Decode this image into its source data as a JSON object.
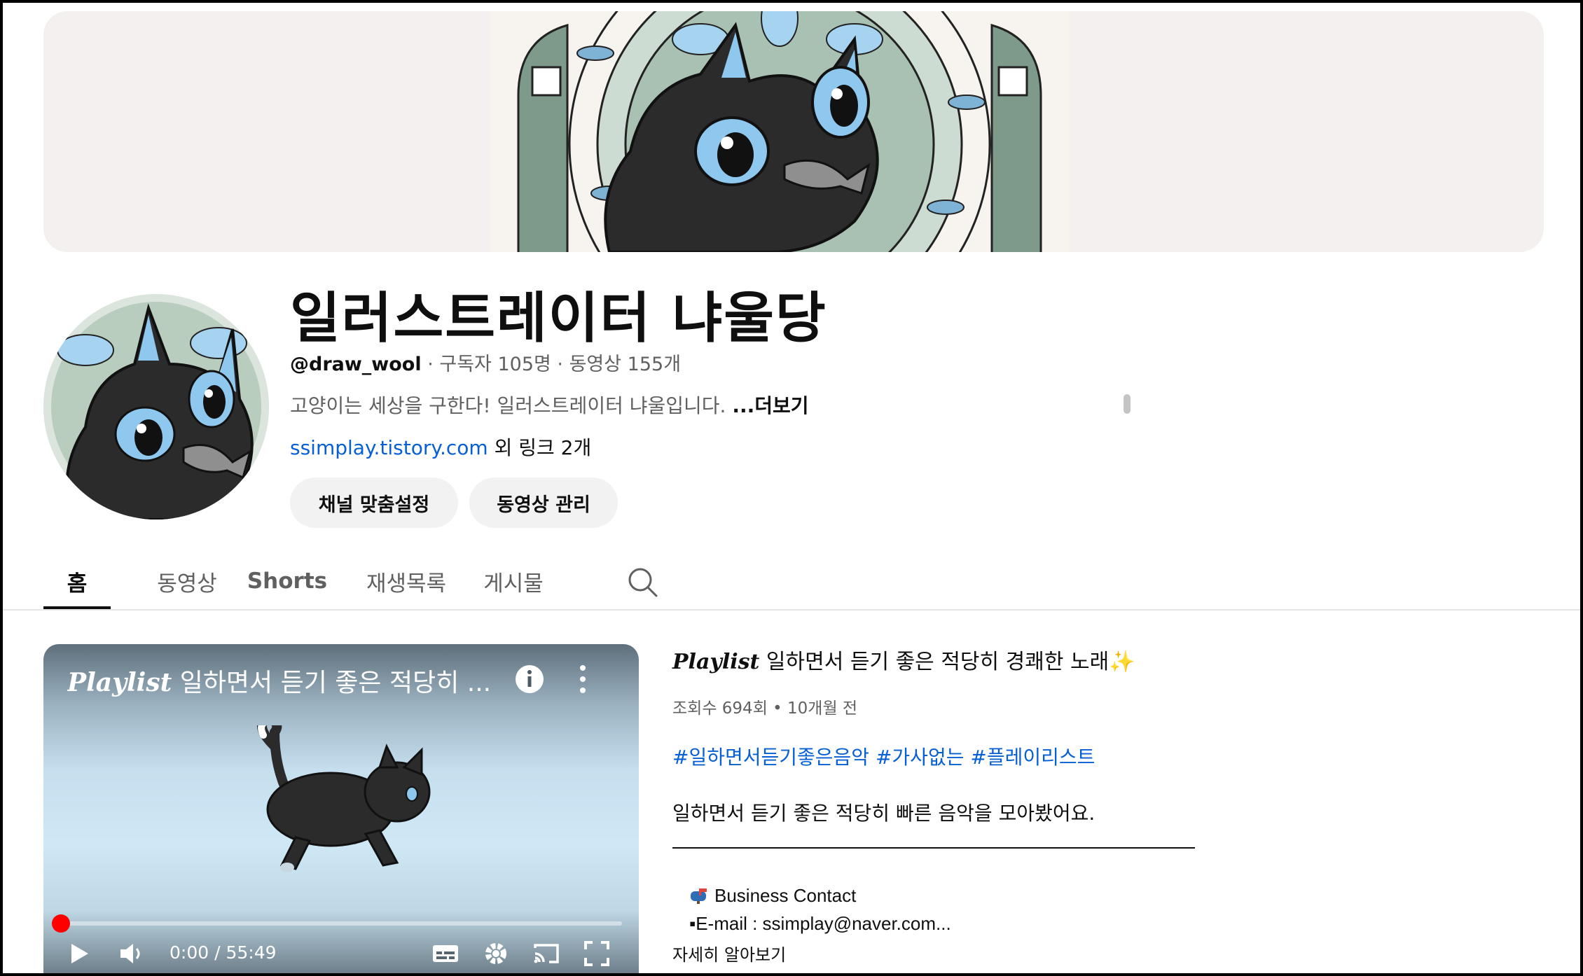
{
  "channel": {
    "title": "일러스트레이터 냐울당",
    "handle": "@draw_wool",
    "meta_rest": " · 구독자 105명 · 동영상 155개",
    "description": "고양이는 세상을 구한다! 일러스트레이터 냐울입니다. ",
    "more_label": "...더보기",
    "link_url": "ssimplay.tistory.com",
    "link_extra": " 외 링크 2개",
    "customize_label": "채널 맞춤설정",
    "manage_label": "동영상 관리"
  },
  "tabs": [
    {
      "label": "홈"
    },
    {
      "label": "동영상"
    },
    {
      "label": "Shorts"
    },
    {
      "label": "재생목록"
    },
    {
      "label": "게시물"
    }
  ],
  "player": {
    "title_playlist": "Playlist",
    "title_rest": " 일하면서 듣기 좋은 적당히 ...",
    "time": "0:00 / 55:49",
    "progress": 0
  },
  "video": {
    "title_playlist": "Playlist",
    "title_rest": " 일하면서 듣기 좋은 적당히 경쾌한 노래",
    "title_emoji": "✨",
    "meta": "조회수 694회 • 10개월 전",
    "tags": "#일하면서듣기좋은음악 #가사없는 #플레이리스트",
    "body": "일하면서 듣기 좋은 적당히 빠른 음악을 모아봤어요.",
    "contact": "Business Contact",
    "email": "▪E-mail : ssimplay@naver.com...",
    "more": "자세히 알아보기"
  },
  "colors": {
    "link": "#065fd4",
    "accent_red": "#ff0000",
    "banner_bg": "#f3f0ef"
  }
}
